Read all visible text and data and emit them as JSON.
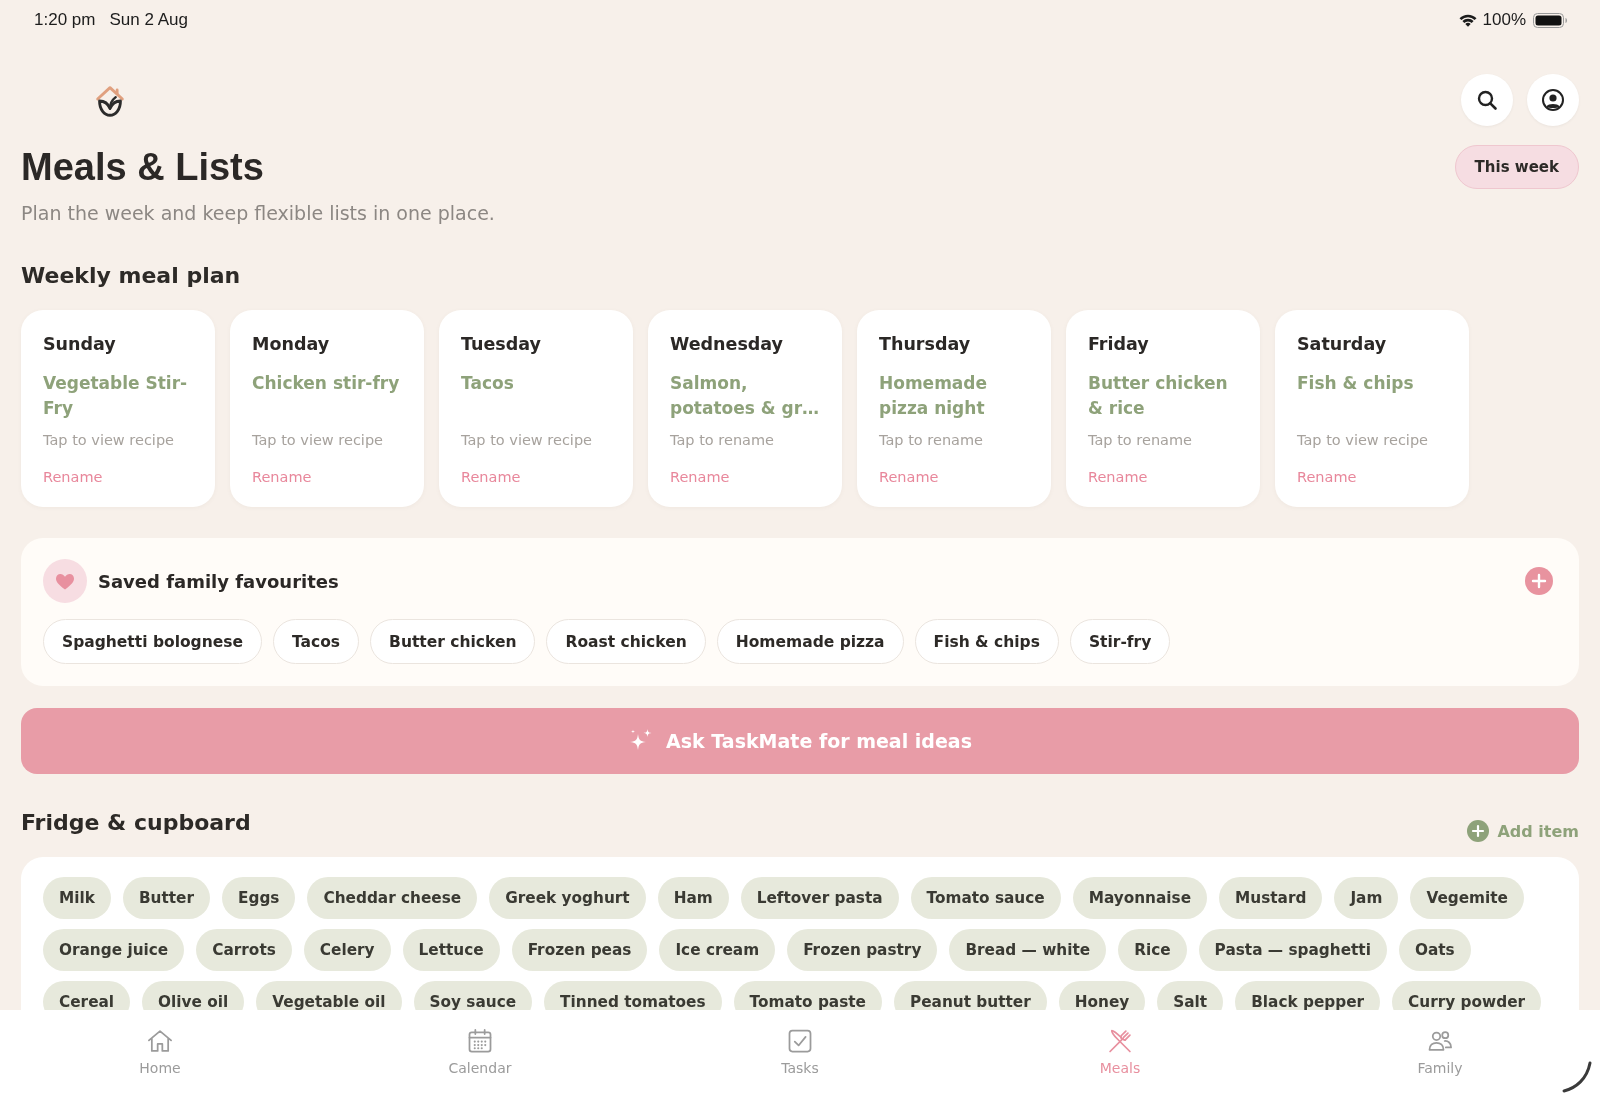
{
  "status_bar": {
    "time": "1:20 pm",
    "date": "Sun 2 Aug",
    "battery": "100%"
  },
  "header": {
    "title": "Meals & Lists",
    "subtitle": "Plan the week and keep flexible lists in one place.",
    "period_button": "This week"
  },
  "meal_plan": {
    "heading": "Weekly meal plan",
    "days": [
      {
        "day": "Sunday",
        "meal": "Vegetable Stir-Fry",
        "hint": "Tap to view recipe",
        "action": "Rename"
      },
      {
        "day": "Monday",
        "meal": "Chicken stir-fry",
        "hint": "Tap to view recipe",
        "action": "Rename"
      },
      {
        "day": "Tuesday",
        "meal": "Tacos",
        "hint": "Tap to view recipe",
        "action": "Rename"
      },
      {
        "day": "Wednesday",
        "meal": "Salmon, potatoes & gr…",
        "hint": "Tap to rename",
        "action": "Rename"
      },
      {
        "day": "Thursday",
        "meal": "Homemade pizza night",
        "hint": "Tap to rename",
        "action": "Rename"
      },
      {
        "day": "Friday",
        "meal": "Butter chicken & rice",
        "hint": "Tap to rename",
        "action": "Rename"
      },
      {
        "day": "Saturday",
        "meal": "Fish & chips",
        "hint": "Tap to view recipe",
        "action": "Rename"
      }
    ]
  },
  "favourites": {
    "title": "Saved family favourites",
    "items": [
      "Spaghetti bolognese",
      "Tacos",
      "Butter chicken",
      "Roast chicken",
      "Homemade pizza",
      "Fish & chips",
      "Stir-fry"
    ]
  },
  "ask_button": "Ask TaskMate for meal ideas",
  "pantry": {
    "heading": "Fridge & cupboard",
    "add_button": "Add item",
    "items": [
      "Milk",
      "Butter",
      "Eggs",
      "Cheddar cheese",
      "Greek yoghurt",
      "Ham",
      "Leftover pasta",
      "Tomato sauce",
      "Mayonnaise",
      "Mustard",
      "Jam",
      "Vegemite",
      "Orange juice",
      "Carrots",
      "Celery",
      "Lettuce",
      "Frozen peas",
      "Ice cream",
      "Frozen pastry",
      "Bread — white",
      "Rice",
      "Pasta — spaghetti",
      "Oats",
      "Cereal",
      "Olive oil",
      "Vegetable oil",
      "Soy sauce",
      "Tinned tomatoes",
      "Tomato paste",
      "Peanut butter",
      "Honey",
      "Salt",
      "Black pepper",
      "Curry powder"
    ]
  },
  "tab_bar": [
    {
      "label": "Home",
      "selected": false
    },
    {
      "label": "Calendar",
      "selected": false
    },
    {
      "label": "Tasks",
      "selected": false
    },
    {
      "label": "Meals",
      "selected": true
    },
    {
      "label": "Family",
      "selected": false
    }
  ]
}
